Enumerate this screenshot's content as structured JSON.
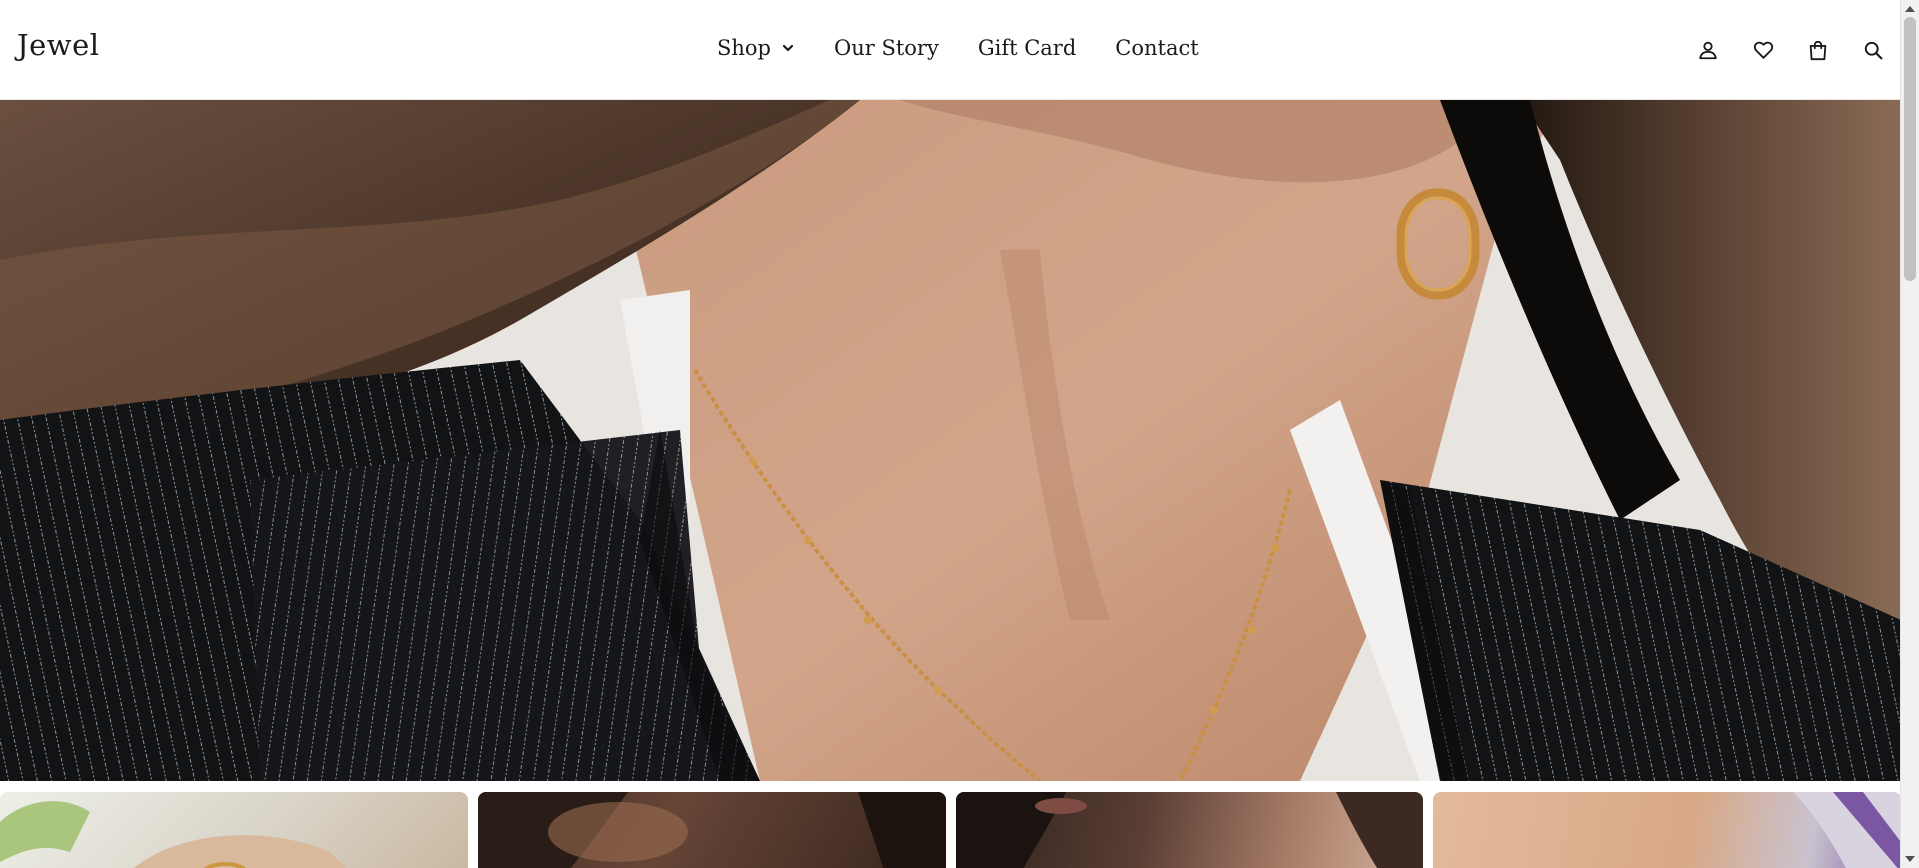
{
  "header": {
    "logo": "Jewel",
    "nav": [
      {
        "label": "Shop",
        "has_dropdown": true
      },
      {
        "label": "Our Story"
      },
      {
        "label": "Gift Card"
      },
      {
        "label": "Contact"
      }
    ],
    "icons": [
      "account-icon",
      "wishlist-heart-icon",
      "shopping-bag-icon",
      "search-icon"
    ]
  },
  "hero": {
    "image": "woman-wearing-gold-chain-necklace-and-gold-oval-earring-pinstripe-blazer"
  },
  "tiles": [
    {
      "image": "gold-bracelet-with-plant"
    },
    {
      "image": "model-curly-hair-portrait"
    },
    {
      "image": "model-curly-hair-lips-closeup"
    },
    {
      "image": "skin-closeup-purple-fabric"
    }
  ],
  "colors": {
    "text": "#1a1a1a",
    "background": "#ffffff",
    "gold": "#c8923f"
  }
}
